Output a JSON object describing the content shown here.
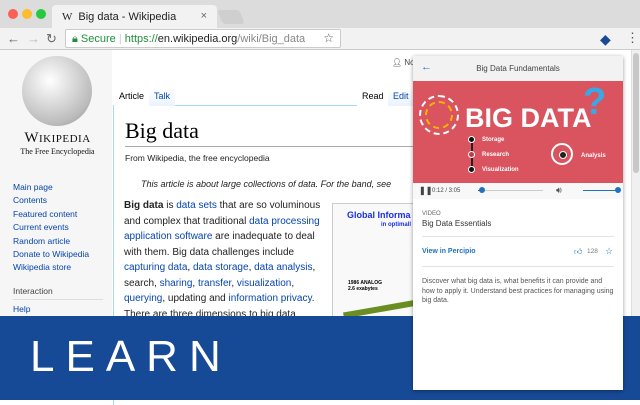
{
  "browser": {
    "tab_title": "Big data - Wikipedia",
    "tab_favicon": "W",
    "secure_label": "Secure",
    "url_scheme": "https://",
    "url_host": "en.wikipedia.org",
    "url_path": "/wiki/Big_data"
  },
  "wiki": {
    "wordmark": "Wikipedia",
    "tagline": "The Free Encyclopedia",
    "nav": [
      "Main page",
      "Contents",
      "Featured content",
      "Current events",
      "Random article",
      "Donate to Wikipedia",
      "Wikipedia store"
    ],
    "interaction_heading": "Interaction",
    "help": "Help",
    "user_label": "No",
    "tabs": {
      "article": "Article",
      "talk": "Talk",
      "read": "Read",
      "edit": "Edit"
    },
    "title": "Big data",
    "from": "From Wikipedia, the free encyclopedia",
    "hatnote": "This article is about large collections of data. For the band, see",
    "figure": {
      "title": "Global Informa",
      "subtitle": "in optimall",
      "label": "1986 ANALOG 2.6 exabytes"
    }
  },
  "popup": {
    "header": "Big Data Fundamentals",
    "hero_title": "BIG DATA",
    "hero_items": [
      "Storage",
      "Research",
      "Visualization"
    ],
    "hero_analysis": "Analysis",
    "time": "0:12 / 3:05",
    "progress": 0.065,
    "volume": 1.0,
    "type": "VIDEO",
    "title": "Big Data Essentials",
    "view_link": "View in Percipio",
    "likes": "128",
    "description": "Discover what big data is, what benefits it can provide and how to apply it. Understand best practices for managing using big data."
  },
  "banner": {
    "text": "LEARN"
  }
}
